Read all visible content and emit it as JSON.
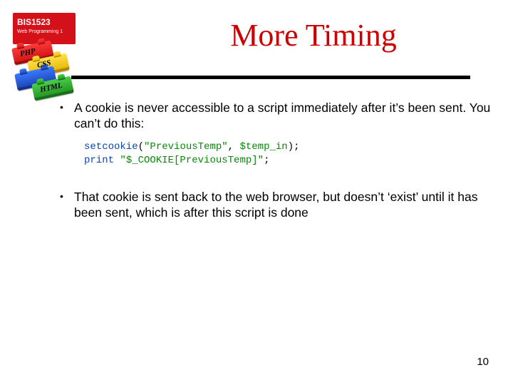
{
  "badge": {
    "code": "BIS1523",
    "sub": "Web Programming 1"
  },
  "legos": {
    "php": "PHP",
    "css": "CSS",
    "html": "HTML"
  },
  "title": "More Timing",
  "bullets": {
    "b1": "A cookie is never accessible to a script immediately after it’s been sent.  You can’t do this:",
    "b2": "That cookie is sent back to the web browser, but doesn’t ‘exist’ until it has been sent, which is after this script is done"
  },
  "code": {
    "fn_setcookie": "setcookie",
    "arg1": "\"PreviousTemp\"",
    "arg2": "$temp_in",
    "fn_print": "print",
    "printarg": "\"$_COOKIE[PreviousTemp]\""
  },
  "page": "10"
}
